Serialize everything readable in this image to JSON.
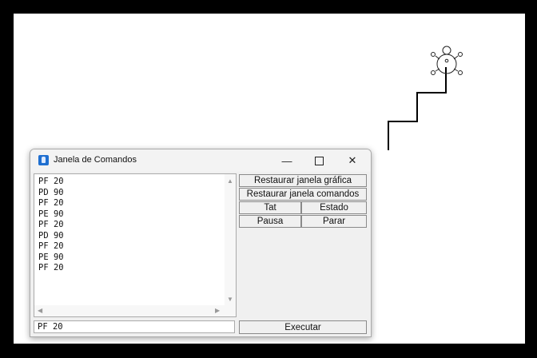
{
  "window": {
    "title": "Janela de Comandos",
    "minimize": "—",
    "close": "✕"
  },
  "commands": {
    "history": [
      "PF 20",
      "PD 90",
      "PF 20",
      "PE 90",
      "PF 20",
      "PD 90",
      "PF 20",
      "PE 90",
      "PF 20"
    ]
  },
  "buttons": {
    "restore_graphic": "Restaurar janela gráfica",
    "restore_commands": "Restaurar janela comandos",
    "tat": "Tat",
    "state": "Estado",
    "pause": "Pausa",
    "stop": "Parar",
    "execute": "Executar"
  },
  "input": {
    "value": "PF 20"
  },
  "colors": {
    "canvas_bg": "#ffffff",
    "frame": "#000000",
    "line": "#000000"
  }
}
